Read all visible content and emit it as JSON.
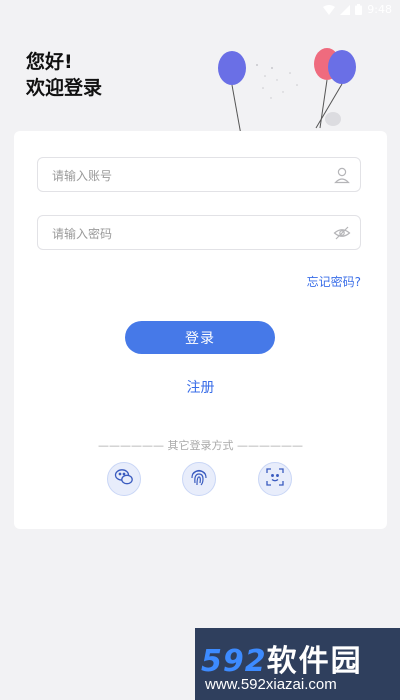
{
  "status_bar": {
    "time": "9:48"
  },
  "greeting": {
    "line1": "您好!",
    "line2": "欢迎登录"
  },
  "form": {
    "account_placeholder": "请输入账号",
    "password_placeholder": "请输入密码",
    "forgot_label": "忘记密码?",
    "login_label": "登录",
    "register_label": "注册",
    "other_methods_label": "—————— 其它登录方式 ——————"
  },
  "social_logins": [
    {
      "icon": "wechat-icon"
    },
    {
      "icon": "fingerprint-icon"
    },
    {
      "icon": "face-scan-icon"
    }
  ],
  "watermark": {
    "brand_num": "592",
    "brand_cn": "软件园",
    "url": "www.592xiazai.com"
  },
  "colors": {
    "accent": "#4679e8",
    "link": "#3a6ee8",
    "background": "#f2f2f4"
  }
}
